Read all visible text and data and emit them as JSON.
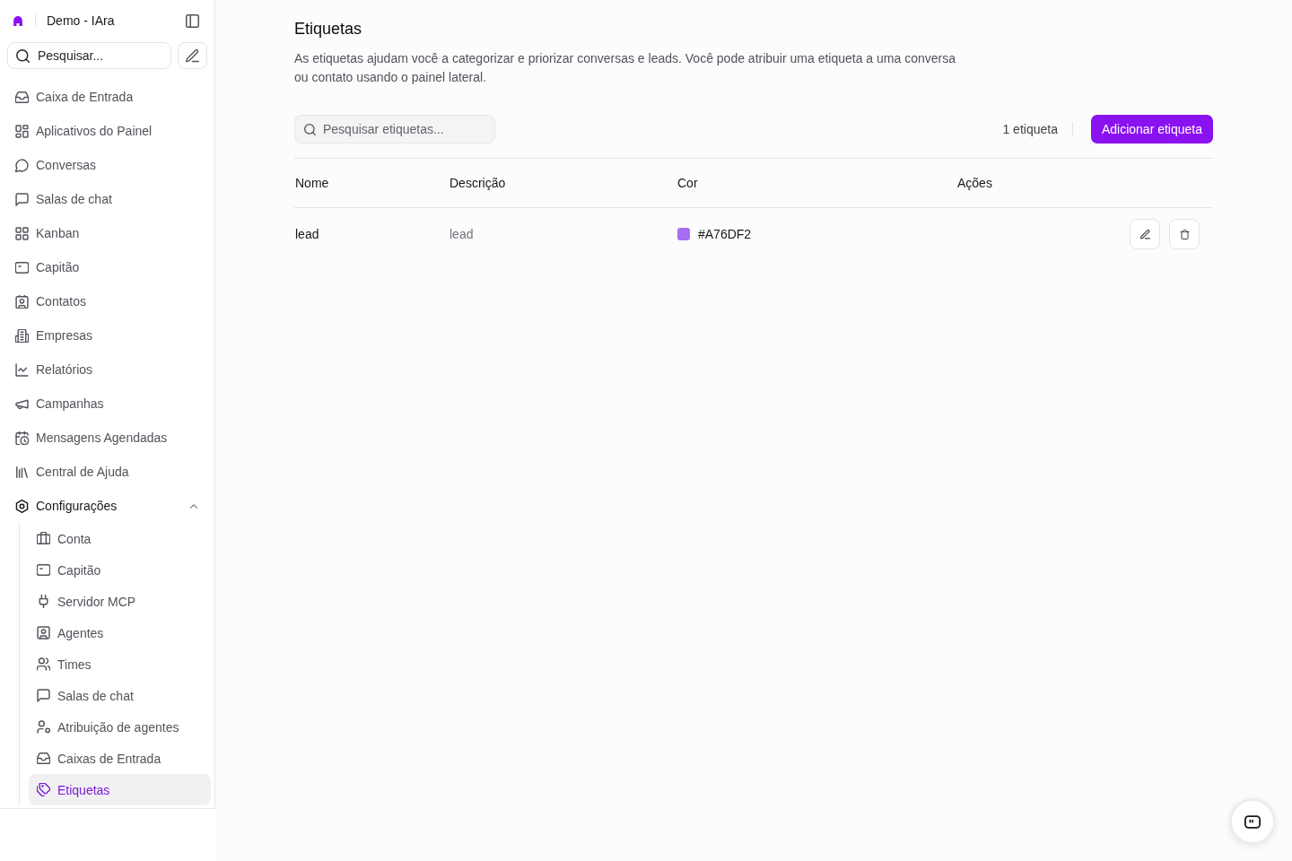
{
  "sidebar": {
    "workspace": "Demo - IAra",
    "search_button": "Pesquisar...",
    "items": [
      {
        "label": "Caixa de Entrada",
        "selected": false
      },
      {
        "label": "Aplicativos do Painel",
        "selected": false
      },
      {
        "label": "Conversas",
        "selected": false
      },
      {
        "label": "Salas de chat",
        "selected": false
      },
      {
        "label": "Kanban",
        "selected": false
      },
      {
        "label": "Capitão",
        "selected": false
      },
      {
        "label": "Contatos",
        "selected": false
      },
      {
        "label": "Empresas",
        "selected": false
      },
      {
        "label": "Relatórios",
        "selected": false
      },
      {
        "label": "Campanhas",
        "selected": false
      },
      {
        "label": "Mensagens Agendadas",
        "selected": false
      },
      {
        "label": "Central de Ajuda",
        "selected": false
      },
      {
        "label": "Configurações",
        "selected": false,
        "expanded": true,
        "children": [
          {
            "label": "Conta",
            "selected": false
          },
          {
            "label": "Capitão",
            "selected": false
          },
          {
            "label": "Servidor MCP",
            "selected": false
          },
          {
            "label": "Agentes",
            "selected": false
          },
          {
            "label": "Times",
            "selected": false
          },
          {
            "label": "Salas de chat",
            "selected": false
          },
          {
            "label": "Atribuição de agentes",
            "selected": false
          },
          {
            "label": "Caixas de Entrada",
            "selected": false
          },
          {
            "label": "Etiquetas",
            "selected": true
          }
        ]
      }
    ]
  },
  "page": {
    "title": "Etiquetas",
    "description": "As etiquetas ajudam você a categorizar e priorizar conversas e leads. Você pode atribuir uma etiqueta a uma conversa ou contato usando o painel lateral.",
    "search": {
      "placeholder": "Pesquisar etiquetas..."
    },
    "count": "1 etiqueta",
    "add_button": "Adicionar etiqueta"
  },
  "table": {
    "columns": [
      "Nome",
      "Descrição",
      "Cor",
      "Ações"
    ],
    "rows": [
      {
        "name": "lead",
        "description": "lead",
        "color": "#a76df2",
        "color_code": "#A76DF2"
      }
    ]
  }
}
